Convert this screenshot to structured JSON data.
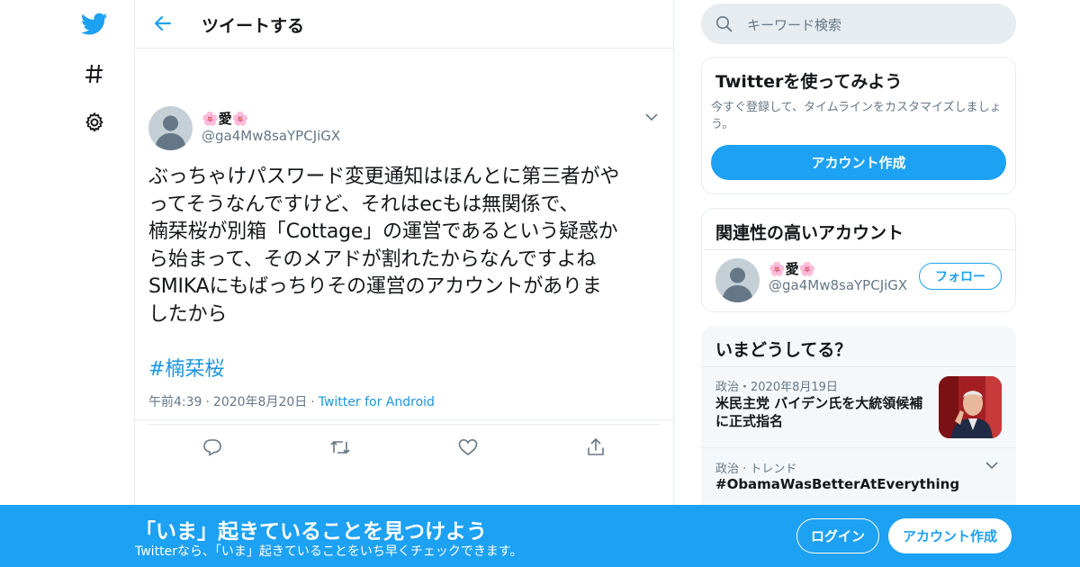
{
  "nav": {
    "logo": "twitter-bird-icon",
    "items": [
      "hashtag-icon",
      "gear-icon"
    ]
  },
  "header": {
    "title": "ツイートする"
  },
  "tweet": {
    "author_name": "🌸愛🌸",
    "author_handle": "@ga4Mw8saYPCJiGX",
    "lines": [
      "ぶっちゃけパスワード変更通知はほんとに第三者がや",
      "ってそうなんですけど、それはecもは無関係で、",
      "楠栞桜が別箱「Cottage」の運営であるという疑惑か",
      "ら始まって、そのメアドが割れたからなんですよね",
      "SMIKAにもばっちりその運営のアカウントがありま",
      "したから"
    ],
    "hashtag": "#楠栞桜",
    "time": "午前4:39",
    "date": "2020年8月20日",
    "source": "Twitter for Android",
    "sep": "·"
  },
  "search": {
    "placeholder": "キーワード検索"
  },
  "signup": {
    "title": "Twitterを使ってみよう",
    "description": "今すぐ登録して、タイムラインをカスタマイズしましょう。",
    "button": "アカウント作成"
  },
  "related": {
    "title": "関連性の高いアカウント",
    "name": "🌸愛🌸",
    "handle": "@ga4Mw8saYPCJiGX",
    "follow": "フォロー"
  },
  "trends": {
    "title": "いまどうしてる？",
    "items": [
      {
        "meta": "政治・2020年8月19日",
        "title_line1": "米民主党 バイデン氏を大統領候補",
        "title_line2": "に正式指名"
      },
      {
        "meta": "政治 · トレンド",
        "title_line1": "#ObamaWasBetterAtEverything"
      }
    ]
  },
  "banner": {
    "title": "「いま」起きていることを見つけよう",
    "subtitle": "Twitterなら、「いま」起きていることをいち早くチェックできます。",
    "login": "ログイン",
    "create": "アカウント作成"
  },
  "colors": {
    "accent": "#1da1f2",
    "link": "#1b95e0",
    "secondary_text": "#657786",
    "border": "#e6ecf0"
  }
}
